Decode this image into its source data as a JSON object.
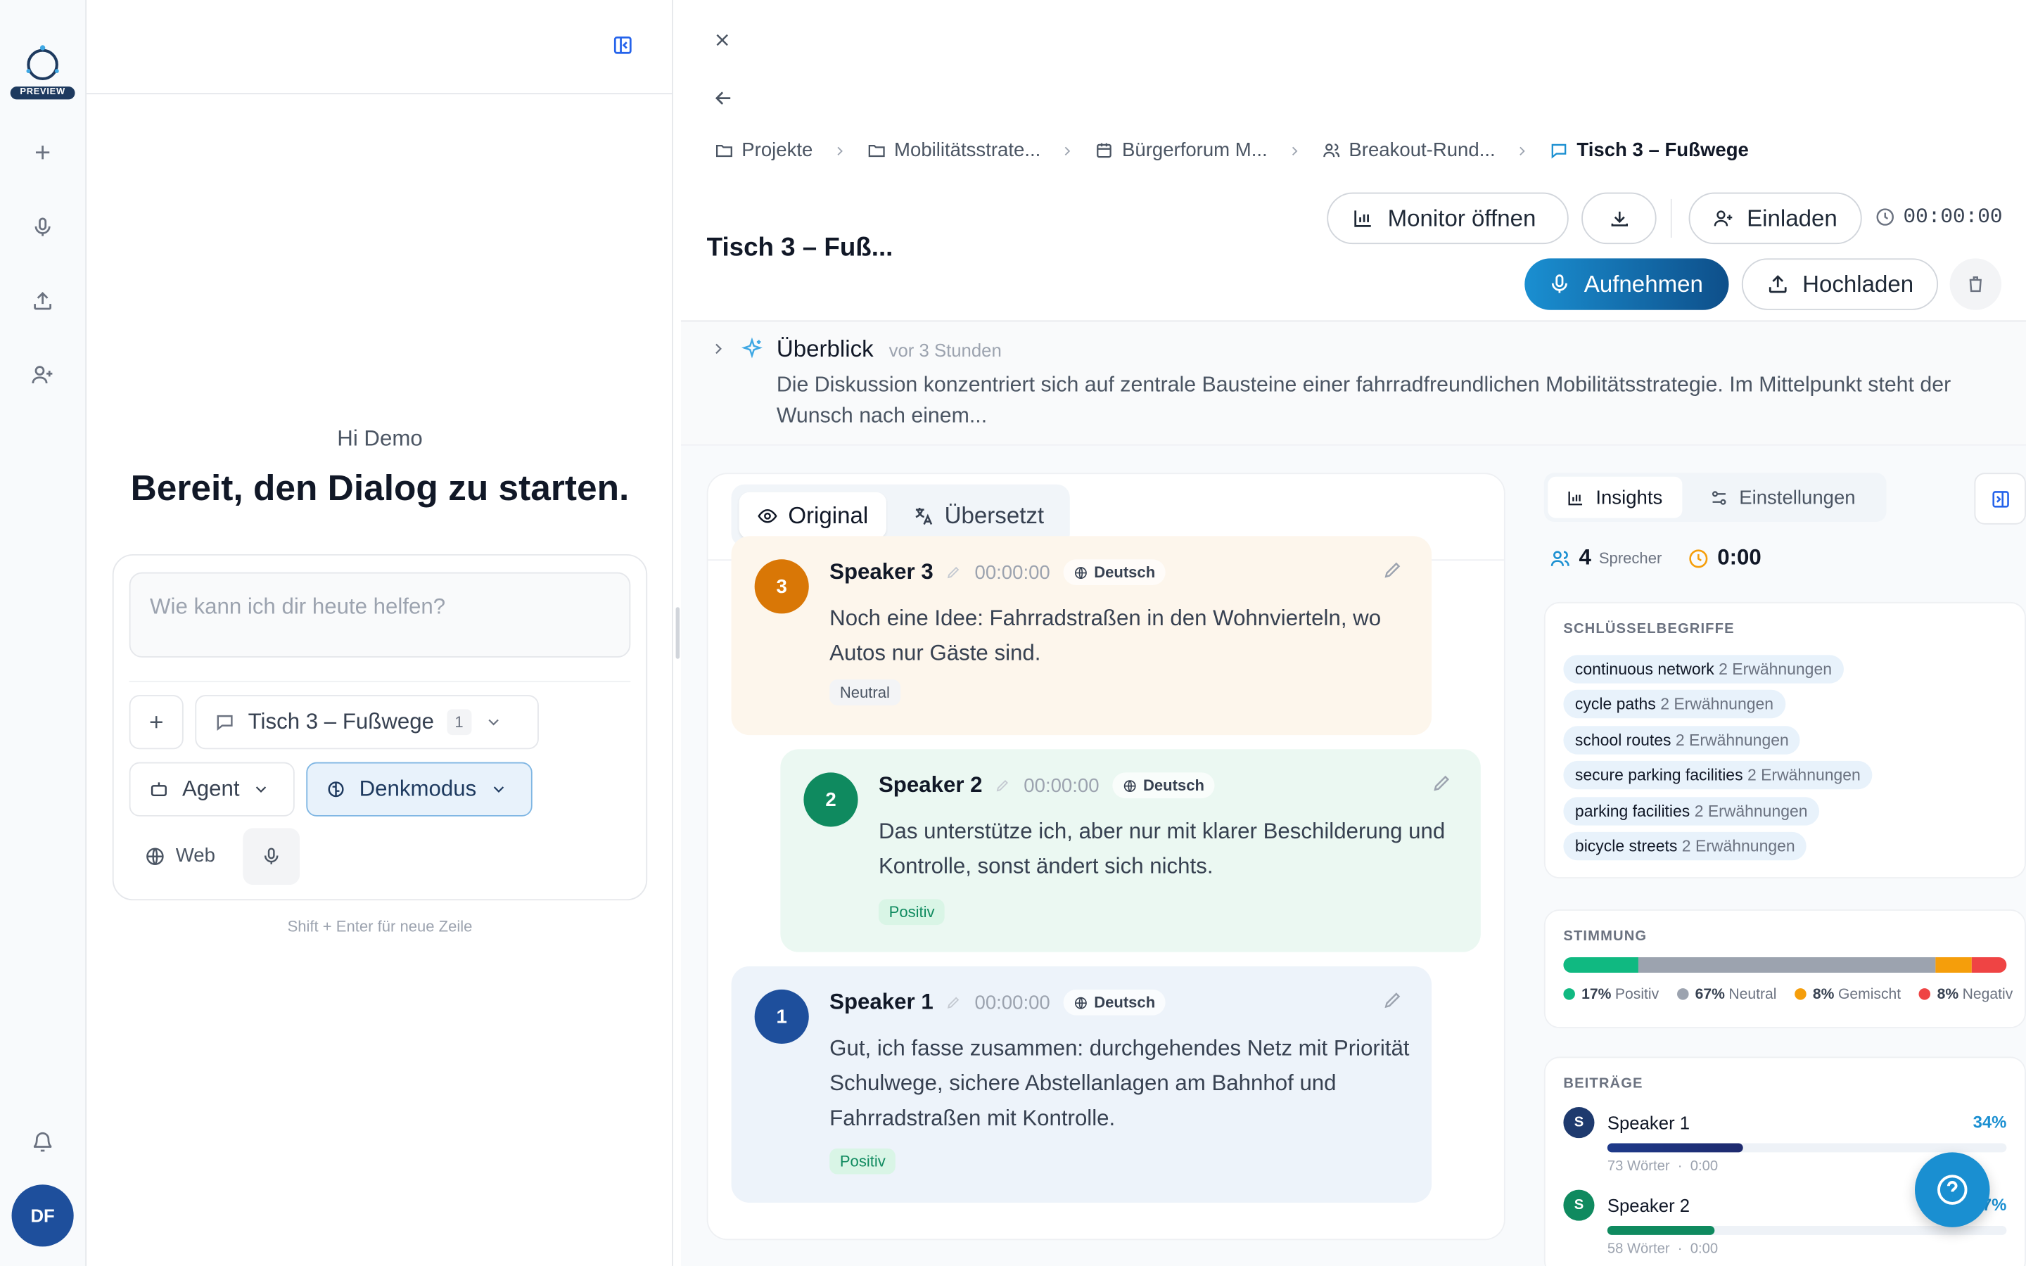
{
  "rail": {
    "badge": "PREVIEW",
    "avatar_initials": "DF",
    "icons": [
      "plus-icon",
      "microphone-icon",
      "upload-icon",
      "add-user-icon",
      "bell-icon"
    ]
  },
  "chat": {
    "greeting": "Hi Demo",
    "headline": "Bereit, den Dialog zu starten.",
    "input_placeholder": "Wie kann ich dir heute helfen?",
    "context_label": "Tisch 3 – Fußwege",
    "context_count": "1",
    "agent_label": "Agent",
    "mode_label": "Denkmodus",
    "web_label": "Web",
    "hint": "Shift + Enter für neue Zeile"
  },
  "breadcrumbs": [
    {
      "label": "Projekte",
      "icon": "folder-icon"
    },
    {
      "label": "Mobilitätsstrate...",
      "icon": "folder-icon"
    },
    {
      "label": "Bürgerforum M...",
      "icon": "calendar-icon"
    },
    {
      "label": "Breakout-Rund...",
      "icon": "users-icon"
    },
    {
      "label": "Tisch 3 – Fußwege",
      "icon": "chat-icon"
    }
  ],
  "header": {
    "title": "Tisch 3 – Fuß...",
    "monitor_label": "Monitor öffnen",
    "invite_label": "Einladen",
    "timer": "00:00:00",
    "record_label": "Aufnehmen",
    "upload_label": "Hochladen"
  },
  "overview": {
    "title": "Überblick",
    "time": "vor 3 Stunden",
    "text": "Die Diskussion konzentriert sich auf zentrale Bausteine einer fahrradfreundlichen Mobilitätsstrategie. Im Mittelpunkt steht der Wunsch nach einem..."
  },
  "transcript": {
    "tab_original": "Original",
    "tab_translated": "Übersetzt",
    "messages": [
      {
        "num": "3",
        "speaker": "Speaker 3",
        "time": "00:00:00",
        "lang": "Deutsch",
        "text": "Noch eine Idee: Fahrradstraßen in den Wohnvierteln, wo Autos nur Gäste sind.",
        "sentiment": "Neutral"
      },
      {
        "num": "2",
        "speaker": "Speaker 2",
        "time": "00:00:00",
        "lang": "Deutsch",
        "text": "Das unterstütze ich, aber nur mit klarer Beschilderung und Kontrolle, sonst ändert sich nichts.",
        "sentiment": "Positiv"
      },
      {
        "num": "1",
        "speaker": "Speaker 1",
        "time": "00:00:00",
        "lang": "Deutsch",
        "text": "Gut, ich fasse zusammen: durchgehendes Netz mit Priorität Schulwege, sichere Abstellanlagen am Bahnhof und Fahrradstraßen mit Kontrolle.",
        "sentiment": "Positiv"
      }
    ]
  },
  "insights": {
    "tab_insights": "Insights",
    "tab_settings": "Einstellungen",
    "speaker_count": "4",
    "speaker_label": "Sprecher",
    "duration": "0:00",
    "keywords_title": "SCHLÜSSELBEGRIFFE",
    "keywords": [
      {
        "term": "continuous network",
        "mentions": "2 Erwähnungen"
      },
      {
        "term": "cycle paths",
        "mentions": "2 Erwähnungen"
      },
      {
        "term": "school routes",
        "mentions": "2 Erwähnungen"
      },
      {
        "term": "secure parking facilities",
        "mentions": "2 Erwähnungen"
      },
      {
        "term": "parking facilities",
        "mentions": "2 Erwähnungen"
      },
      {
        "term": "bicycle streets",
        "mentions": "2 Erwähnungen"
      }
    ],
    "sentiment_title": "STIMMUNG",
    "sentiment": [
      {
        "pct": "17%",
        "label": "Positiv",
        "value": 17,
        "color": "#10b981"
      },
      {
        "pct": "67%",
        "label": "Neutral",
        "value": 67,
        "color": "#9ca3af"
      },
      {
        "pct": "8%",
        "label": "Gemischt",
        "value": 8,
        "color": "#f59e0b"
      },
      {
        "pct": "8%",
        "label": "Negativ",
        "value": 8,
        "color": "#ef4444"
      }
    ],
    "contrib_title": "BEITRÄGE",
    "contributions": [
      {
        "initial": "S",
        "name": "Speaker 1",
        "pct": "34%",
        "value": 34,
        "words": "73 Wörter",
        "time": "0:00"
      },
      {
        "initial": "S",
        "name": "Speaker 2",
        "pct": "27%",
        "value": 27,
        "words": "58 Wörter",
        "time": "0:00"
      }
    ]
  },
  "colors": {
    "accent": "#1a8fd1",
    "speaker3": "#d97706",
    "speaker2": "#0f8a5f",
    "speaker1": "#1e4f9c"
  }
}
